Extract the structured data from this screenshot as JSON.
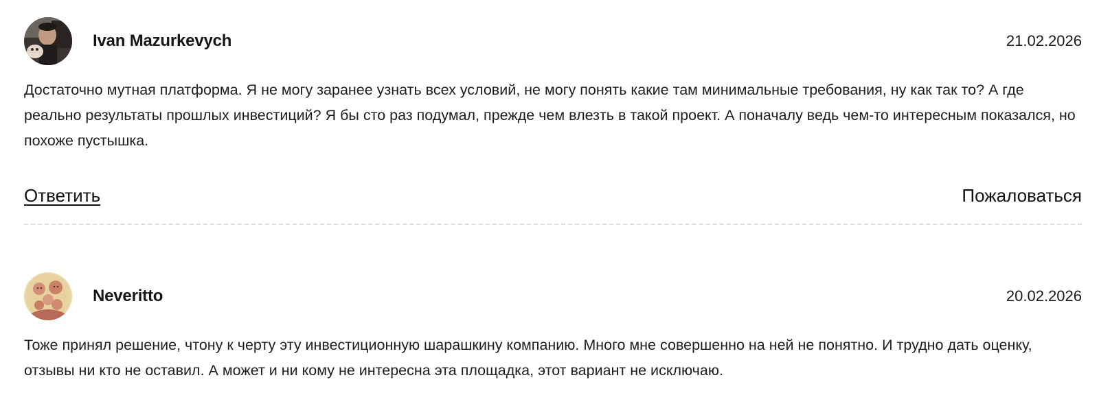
{
  "comments": [
    {
      "author": "Ivan Mazurkevych",
      "date": "21.02.2026",
      "text": "Достаточно мутная платформа. Я не могу заранее узнать всех условий, не могу понять какие там минимальные требования, ну как так то? А где реально результаты прошлых инвестиций? Я бы сто раз подумал, прежде чем влезть в такой проект. А поначалу ведь чем-то интересным показался, но похоже пустышка.",
      "reply_label": "Ответить",
      "report_label": "Пожаловаться",
      "avatar_icon": "user-photo-avatar"
    },
    {
      "author": "Neveritto",
      "date": "20.02.2026",
      "text": "Тоже принял решение, чтону к черту эту инвестиционную шарашкину компанию. Много мне совершенно на ней не понятно. И трудно дать оценку, отзывы ни кто не оставил. А может и ни кому не интересна эта площадка, этот вариант не исключаю.",
      "avatar_icon": "drawing-avatar"
    }
  ]
}
